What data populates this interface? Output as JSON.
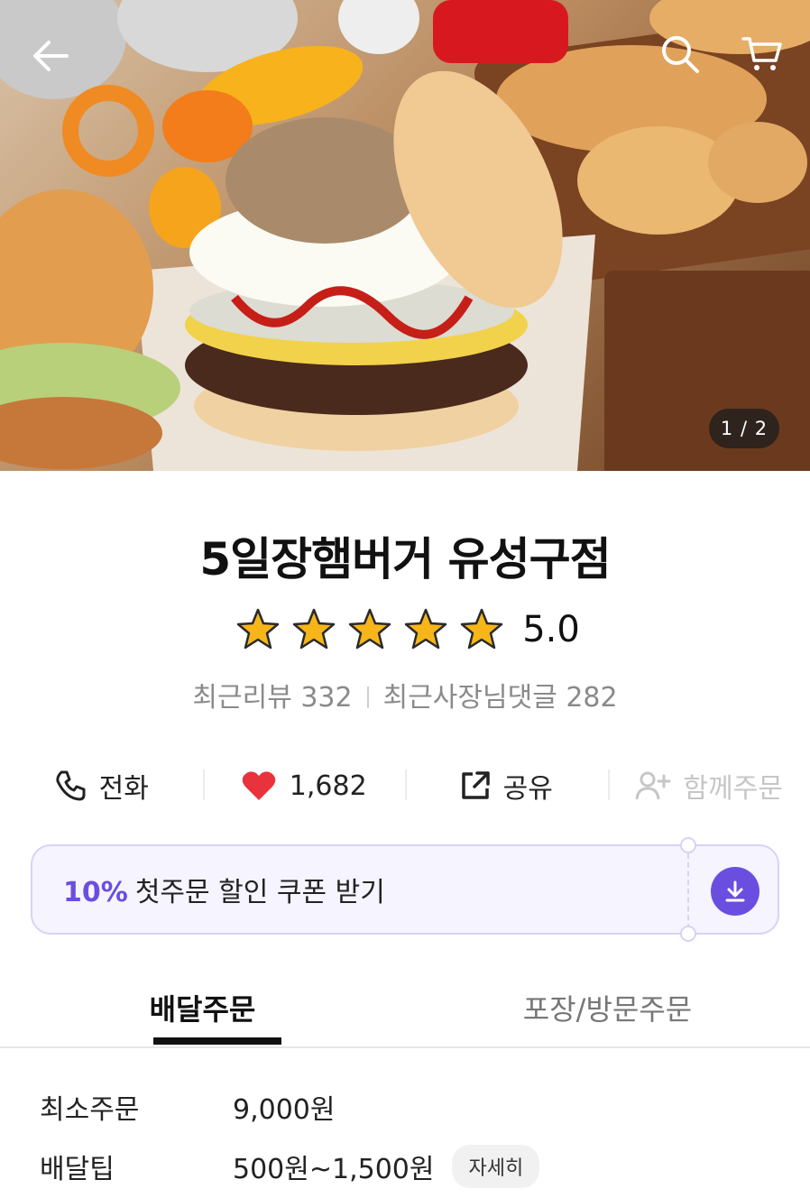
{
  "hero": {
    "page_indicator": "1 / 2",
    "icons": {
      "back": "arrow-left-icon",
      "search": "search-icon",
      "cart": "cart-icon"
    }
  },
  "store": {
    "name": "5일장햄버거 유성구점",
    "rating": 5.0,
    "rating_text": "5.0",
    "stars": 5,
    "recent_reviews": "최근리뷰 332",
    "owner_replies": "최근사장님댓글 282"
  },
  "actions": {
    "call_label": "전화",
    "like_count": "1,682",
    "share_label": "공유",
    "group_order_label": "함께주문"
  },
  "coupon": {
    "percent": "10%",
    "text": "첫주문 할인 쿠폰 받기"
  },
  "tabs": [
    {
      "label": "배달주문",
      "active": true
    },
    {
      "label": "포장/방문주문",
      "active": false
    }
  ],
  "delivery_info": {
    "min_order_label": "최소주문",
    "min_order_value": "9,000원",
    "tip_label": "배달팁",
    "tip_value": "500원~1,500원",
    "detail_button": "자세히"
  },
  "colors": {
    "accent": "#6a4ee0",
    "heart": "#e8323c",
    "star": "#f6b619",
    "muted": "#8a8a8a"
  }
}
